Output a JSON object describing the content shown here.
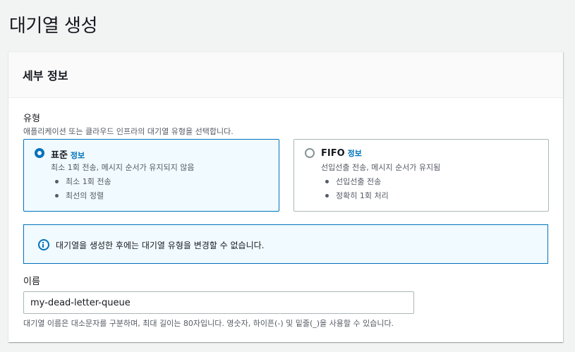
{
  "page": {
    "title": "대기열 생성"
  },
  "section": {
    "title": "세부 정보"
  },
  "type_field": {
    "label": "유형",
    "description": "애플리케이션 또는 클라우드 인프라의 대기열 유형을 선택합니다.",
    "options": [
      {
        "title": "표준",
        "info": "정보",
        "description": "최소 1회 전송, 메시지 순서가 유지되지 않음",
        "bullets": [
          "최소 1회 전송",
          "최선의 정렬"
        ],
        "selected": true
      },
      {
        "title": "FIFO",
        "info": "정보",
        "description": "선입선출 전송, 메시지 순서가 유지됨",
        "bullets": [
          "선입선출 전송",
          "정확히 1회 처리"
        ],
        "selected": false
      }
    ]
  },
  "alert": {
    "text": "대기열을 생성한 후에는 대기열 유형을 변경할 수 없습니다."
  },
  "name_field": {
    "label": "이름",
    "value": "my-dead-letter-queue",
    "description": "대기열 이름은 대소문자를 구분하며, 최대 길이는 80자입니다. 영숫자, 하이픈(-) 및 밑줄(_)을 사용할 수 있습니다."
  },
  "colors": {
    "accent": "#0073bb",
    "selected_bg": "#f1faff",
    "border": "#aab7b8"
  }
}
